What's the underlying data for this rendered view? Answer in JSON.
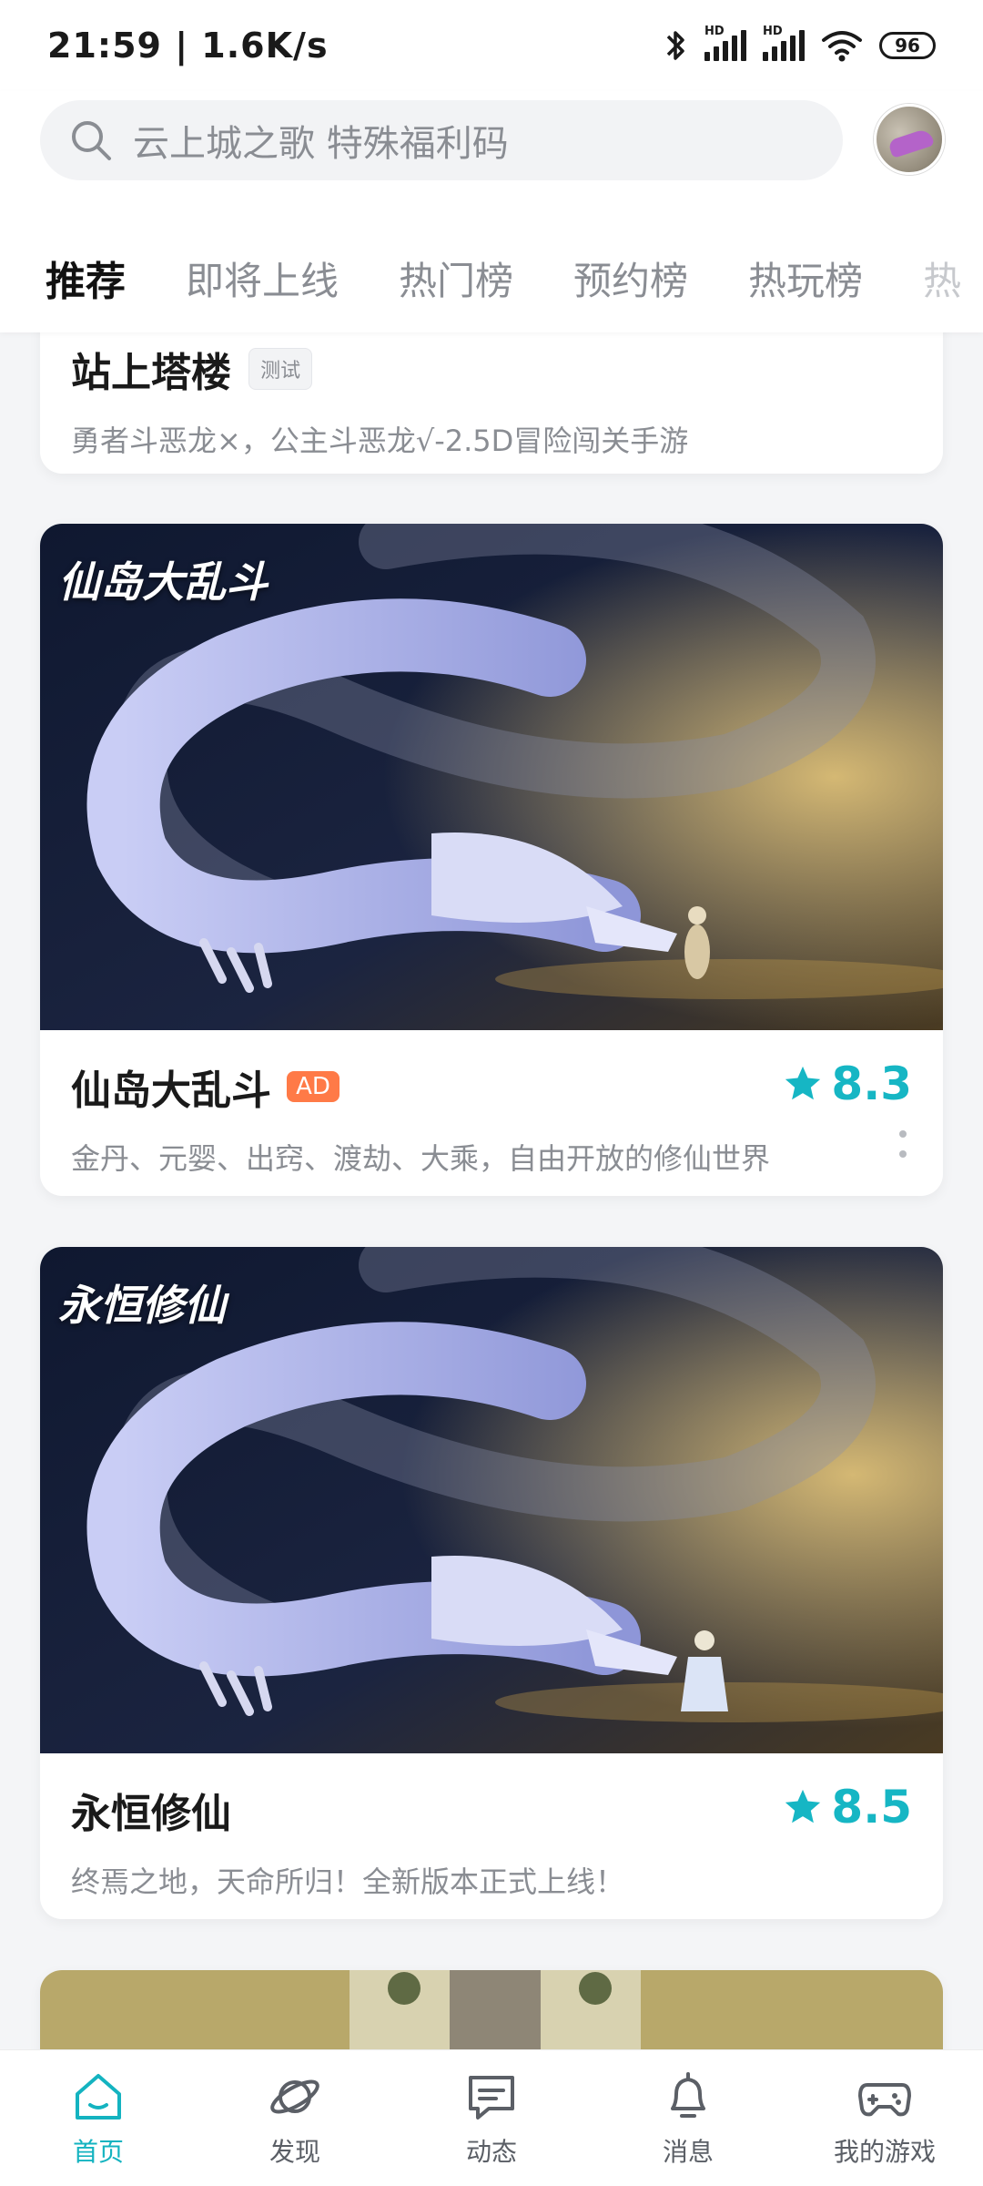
{
  "status_bar": {
    "time_speed": "21:59 | 1.6K/s",
    "battery": "96",
    "hd_label": "HD"
  },
  "search": {
    "placeholder": "云上城之歌 特殊福利码"
  },
  "tabs": [
    {
      "label": "推荐",
      "active": true
    },
    {
      "label": "即将上线"
    },
    {
      "label": "热门榜"
    },
    {
      "label": "预约榜"
    },
    {
      "label": "热玩榜"
    },
    {
      "label": "热"
    }
  ],
  "cards": [
    {
      "title": "站上塔楼",
      "tag": "测试",
      "description": "勇者斗恶龙×，公主斗恶龙√-2.5D冒险闯关手游"
    },
    {
      "title": "仙岛大乱斗",
      "tag": "AD",
      "banner_logo": "仙岛大乱斗",
      "rating": "8.3",
      "description": "金丹、元婴、出窍、渡劫、大乘，自由开放的修仙世界"
    },
    {
      "title": "永恒修仙",
      "banner_logo": "永恒修仙",
      "rating": "8.5",
      "description": "终焉之地，天命所归！全新版本正式上线！"
    }
  ],
  "bottom_nav": [
    {
      "label": "首页",
      "icon": "home-icon",
      "active": true
    },
    {
      "label": "发现",
      "icon": "planet-icon"
    },
    {
      "label": "动态",
      "icon": "chat-icon"
    },
    {
      "label": "消息",
      "icon": "bell-icon"
    },
    {
      "label": "我的游戏",
      "icon": "gamepad-icon"
    }
  ],
  "colors": {
    "accent": "#14c2c6",
    "rating": "#16b6c4",
    "ad_tag": "#ff7a47"
  }
}
